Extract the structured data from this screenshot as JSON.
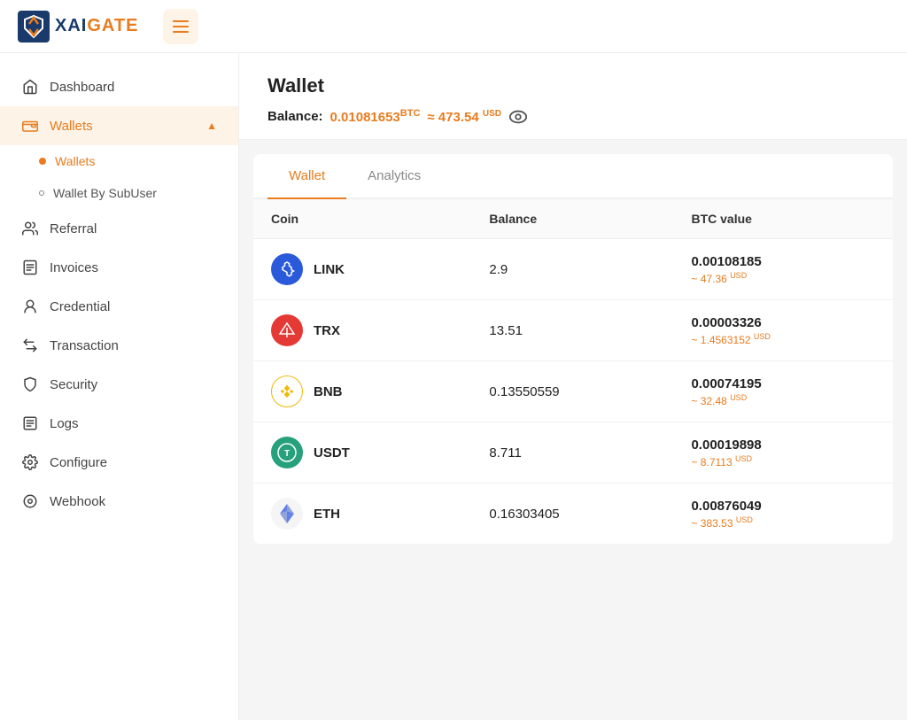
{
  "brand": {
    "name_part1": "XAI",
    "name_part2": "GATE"
  },
  "page": {
    "title": "Wallet",
    "balance_label": "Balance:",
    "balance_btc": "0.01081653",
    "balance_btc_unit": "BTC",
    "balance_approx": "≈ 473.54",
    "balance_usd_unit": "USD"
  },
  "sidebar": {
    "items": [
      {
        "id": "dashboard",
        "label": "Dashboard",
        "icon": "home"
      },
      {
        "id": "wallets",
        "label": "Wallets",
        "icon": "wallet",
        "active": true,
        "expanded": true
      },
      {
        "id": "referral",
        "label": "Referral",
        "icon": "users"
      },
      {
        "id": "invoices",
        "label": "Invoices",
        "icon": "invoice"
      },
      {
        "id": "credential",
        "label": "Credential",
        "icon": "credential"
      },
      {
        "id": "transaction",
        "label": "Transaction",
        "icon": "transaction"
      },
      {
        "id": "security",
        "label": "Security",
        "icon": "security"
      },
      {
        "id": "logs",
        "label": "Logs",
        "icon": "logs"
      },
      {
        "id": "configure",
        "label": "Configure",
        "icon": "configure"
      },
      {
        "id": "webhook",
        "label": "Webhook",
        "icon": "webhook"
      }
    ],
    "sub_items": [
      {
        "id": "wallets-sub",
        "label": "Wallets",
        "active": true
      },
      {
        "id": "wallet-by-subuser",
        "label": "Wallet By SubUser",
        "active": false
      }
    ]
  },
  "tabs": [
    {
      "id": "wallet-tab",
      "label": "Wallet",
      "active": true
    },
    {
      "id": "analytics-tab",
      "label": "Analytics",
      "active": false
    }
  ],
  "table": {
    "columns": [
      "Coin",
      "Balance",
      "BTC value"
    ],
    "rows": [
      {
        "coin": "LINK",
        "coin_color": "#2a5ada",
        "balance": "2.9",
        "btc": "0.00108185",
        "usd": "~ 47.36",
        "usd_unit": "USD"
      },
      {
        "coin": "TRX",
        "coin_color": "#e53935",
        "balance": "13.51",
        "btc": "0.00003326",
        "usd": "~ 1.4563152",
        "usd_unit": "USD"
      },
      {
        "coin": "BNB",
        "coin_color": "#f0b90b",
        "balance": "0.13550559",
        "btc": "0.00074195",
        "usd": "~ 32.48",
        "usd_unit": "USD"
      },
      {
        "coin": "USDT",
        "coin_color": "#26a17b",
        "balance": "8.711",
        "btc": "0.00019898",
        "usd": "~ 8.7113",
        "usd_unit": "USD"
      },
      {
        "coin": "ETH",
        "coin_color": "#627eea",
        "balance": "0.16303405",
        "btc": "0.00876049",
        "usd": "~ 383.53",
        "usd_unit": "USD"
      }
    ]
  }
}
